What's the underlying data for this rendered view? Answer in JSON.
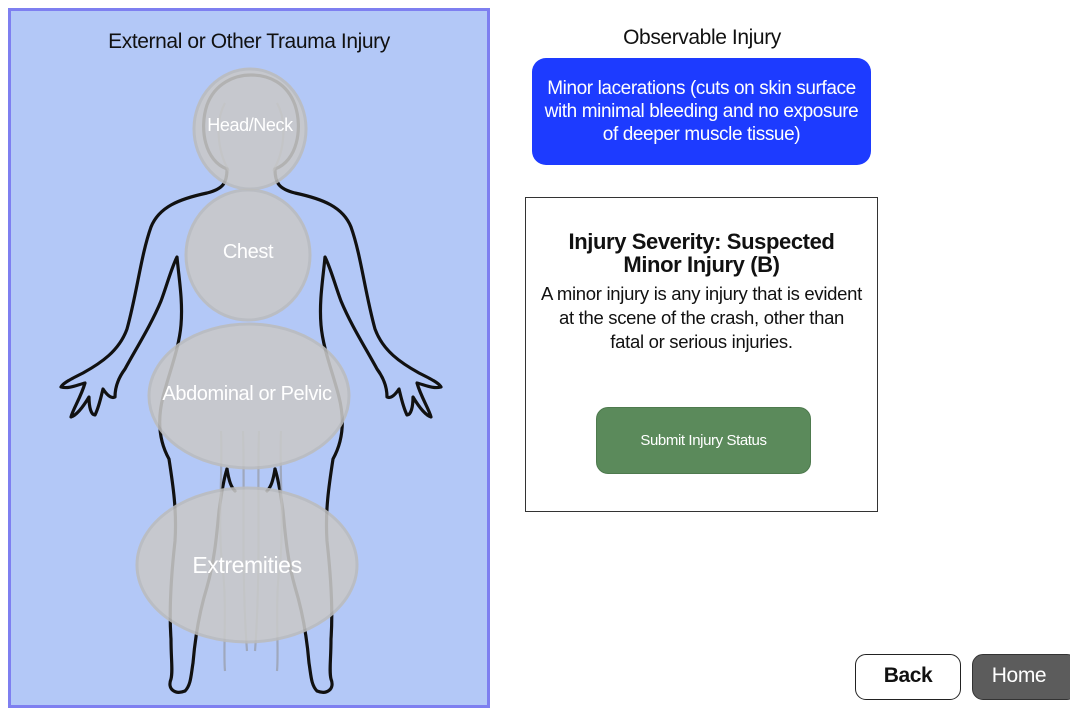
{
  "left_panel": {
    "title": "External or Other Trauma Injury",
    "regions": {
      "head_neck": "Head/Neck",
      "chest": "Chest",
      "abdominal_pelvic": "Abdominal or Pelvic",
      "extremities": "Extremities"
    }
  },
  "observable": {
    "title": "Observable Injury",
    "selected_injury": "Minor lacerations (cuts on skin surface with minimal bleeding and no exposure of deeper muscle tissue)"
  },
  "severity": {
    "heading": "Injury Severity: Suspected Minor Injury (B)",
    "description": "A minor injury is any injury that is evident at the scene of the crash, other than fatal or serious injuries.",
    "submit_label": "Submit Injury Status"
  },
  "nav": {
    "back_label": "Back",
    "home_label": "Home"
  },
  "colors": {
    "panel_bg": "#b3c8f7",
    "panel_border": "#7e7ff0",
    "injury_button": "#1d3bff",
    "submit_button": "#5b8a5b",
    "home_button": "#5c5c5c"
  }
}
